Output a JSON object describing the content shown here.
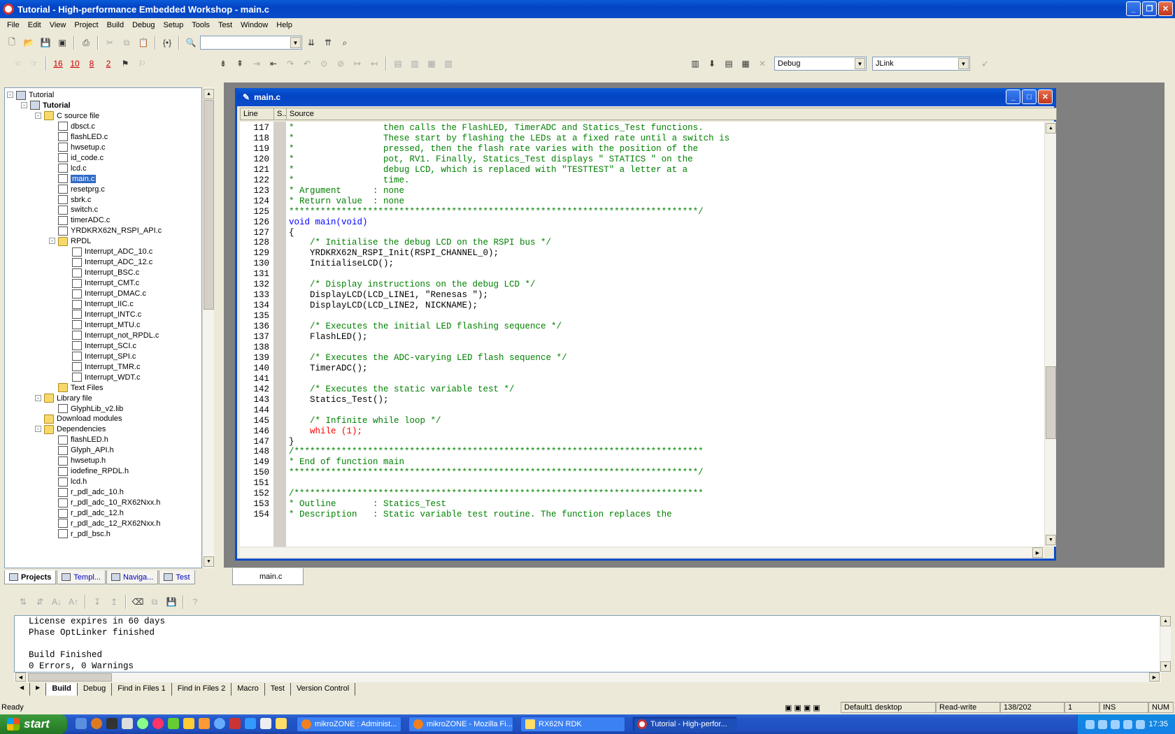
{
  "window": {
    "title": "Tutorial - High-performance Embedded Workshop - main.c"
  },
  "menu": [
    "File",
    "Edit",
    "View",
    "Project",
    "Build",
    "Debug",
    "Setup",
    "Tools",
    "Test",
    "Window",
    "Help"
  ],
  "toolbar": {
    "find_value": "",
    "config_value": "Debug",
    "session_value": "JLink",
    "num_buttons": [
      "16",
      "10",
      "8",
      "2"
    ]
  },
  "tree": {
    "root": "Tutorial",
    "project": "Tutorial",
    "c_folder": "C source file",
    "c_files": [
      "dbsct.c",
      "flashLED.c",
      "hwsetup.c",
      "id_code.c",
      "lcd.c",
      "main.c",
      "resetprg.c",
      "sbrk.c",
      "switch.c",
      "timerADC.c",
      "YRDKRX62N_RSPI_API.c"
    ],
    "rpdl_folder": "RPDL",
    "rpdl_files": [
      "Interrupt_ADC_10.c",
      "Interrupt_ADC_12.c",
      "Interrupt_BSC.c",
      "Interrupt_CMT.c",
      "Interrupt_DMAC.c",
      "Interrupt_IIC.c",
      "Interrupt_INTC.c",
      "Interrupt_MTU.c",
      "Interrupt_not_RPDL.c",
      "Interrupt_SCI.c",
      "Interrupt_SPI.c",
      "Interrupt_TMR.c",
      "Interrupt_WDT.c"
    ],
    "text_folder": "Text Files",
    "lib_folder": "Library file",
    "lib_files": [
      "GlyphLib_v2.lib"
    ],
    "dl_folder": "Download modules",
    "dep_folder": "Dependencies",
    "dep_files": [
      "flashLED.h",
      "Glyph_API.h",
      "hwsetup.h",
      "iodefine_RPDL.h",
      "lcd.h",
      "r_pdl_adc_10.h",
      "r_pdl_adc_10_RX62Nxx.h",
      "r_pdl_adc_12.h",
      "r_pdl_adc_12_RX62Nxx.h",
      "r_pdl_bsc.h"
    ]
  },
  "panel_tabs": [
    "Projects",
    "Templ...",
    "Naviga...",
    "Test"
  ],
  "editor": {
    "title": "main.c",
    "col_line": "Line",
    "col_s": "S..",
    "col_source": "Source",
    "doc_tab": "main.c",
    "lines": [
      {
        "n": "117",
        "t": "*                 then calls the FlashLED, TimerADC and Statics_Test functions.",
        "c": "cm"
      },
      {
        "n": "118",
        "t": "*                 These start by flashing the LEDs at a fixed rate until a switch is",
        "c": "cm"
      },
      {
        "n": "119",
        "t": "*                 pressed, then the flash rate varies with the position of the",
        "c": "cm"
      },
      {
        "n": "120",
        "t": "*                 pot, RV1. Finally, Statics_Test displays \" STATICS \" on the",
        "c": "cm"
      },
      {
        "n": "121",
        "t": "*                 debug LCD, which is replaced with \"TESTTEST\" a letter at a",
        "c": "cm"
      },
      {
        "n": "122",
        "t": "*                 time.",
        "c": "cm"
      },
      {
        "n": "123",
        "t": "* Argument      : none",
        "c": "cm"
      },
      {
        "n": "124",
        "t": "* Return value  : none",
        "c": "cm"
      },
      {
        "n": "125",
        "t": "******************************************************************************/",
        "c": "cm"
      },
      {
        "n": "126",
        "t": "void main(void)",
        "c": "kw"
      },
      {
        "n": "127",
        "t": "{",
        "c": ""
      },
      {
        "n": "128",
        "t": "    /* Initialise the debug LCD on the RSPI bus */",
        "c": "cm"
      },
      {
        "n": "129",
        "t": "    YRDKRX62N_RSPI_Init(RSPI_CHANNEL_0);",
        "c": ""
      },
      {
        "n": "130",
        "t": "    InitialiseLCD();",
        "c": ""
      },
      {
        "n": "131",
        "t": "",
        "c": ""
      },
      {
        "n": "132",
        "t": "    /* Display instructions on the debug LCD */",
        "c": "cm"
      },
      {
        "n": "133",
        "t": "    DisplayLCD(LCD_LINE1, \"Renesas \");",
        "c": ""
      },
      {
        "n": "134",
        "t": "    DisplayLCD(LCD_LINE2, NICKNAME);",
        "c": ""
      },
      {
        "n": "135",
        "t": "",
        "c": ""
      },
      {
        "n": "136",
        "t": "    /* Executes the initial LED flashing sequence */",
        "c": "cm"
      },
      {
        "n": "137",
        "t": "    FlashLED();",
        "c": ""
      },
      {
        "n": "138",
        "t": "",
        "c": ""
      },
      {
        "n": "139",
        "t": "    /* Executes the ADC-varying LED flash sequence */",
        "c": "cm"
      },
      {
        "n": "140",
        "t": "    TimerADC();",
        "c": ""
      },
      {
        "n": "141",
        "t": "",
        "c": ""
      },
      {
        "n": "142",
        "t": "    /* Executes the static variable test */",
        "c": "cm"
      },
      {
        "n": "143",
        "t": "    Statics_Test();",
        "c": ""
      },
      {
        "n": "144",
        "t": "",
        "c": ""
      },
      {
        "n": "145",
        "t": "    /* Infinite while loop */",
        "c": "cm"
      },
      {
        "n": "146",
        "t": "    while (1);",
        "c": "rd"
      },
      {
        "n": "147",
        "t": "}",
        "c": ""
      },
      {
        "n": "148",
        "t": "/******************************************************************************",
        "c": "cm"
      },
      {
        "n": "149",
        "t": "* End of function main",
        "c": "cm"
      },
      {
        "n": "150",
        "t": "******************************************************************************/",
        "c": "cm"
      },
      {
        "n": "151",
        "t": "",
        "c": ""
      },
      {
        "n": "152",
        "t": "/******************************************************************************",
        "c": "cm"
      },
      {
        "n": "153",
        "t": "* Outline       : Statics_Test",
        "c": "cm"
      },
      {
        "n": "154",
        "t": "* Description   : Static variable test routine. The function replaces the",
        "c": "cm"
      }
    ]
  },
  "output": {
    "lines": [
      "License expires in 60 days",
      "Phase OptLinker finished",
      "",
      "Build Finished",
      "0 Errors, 0 Warnings"
    ],
    "tabs": [
      "Build",
      "Debug",
      "Find in Files 1",
      "Find in Files 2",
      "Macro",
      "Test",
      "Version Control"
    ]
  },
  "status": {
    "ready": "Ready",
    "desktop": "Default1 desktop",
    "mode": "Read-write",
    "pos": "138/202",
    "col": "1",
    "ins": "INS",
    "num": "NUM"
  },
  "taskbar": {
    "start": "start",
    "tasks": [
      "mikroZONE : Administ...",
      "mikroZONE - Mozilla Fi...",
      "RX62N RDK",
      "Tutorial - High-perfor..."
    ],
    "clock": "17:35"
  },
  "colors": {
    "comment": "#008000",
    "keyword": "#0000ff",
    "while": "#ff0000",
    "selection": "#316ac5"
  }
}
